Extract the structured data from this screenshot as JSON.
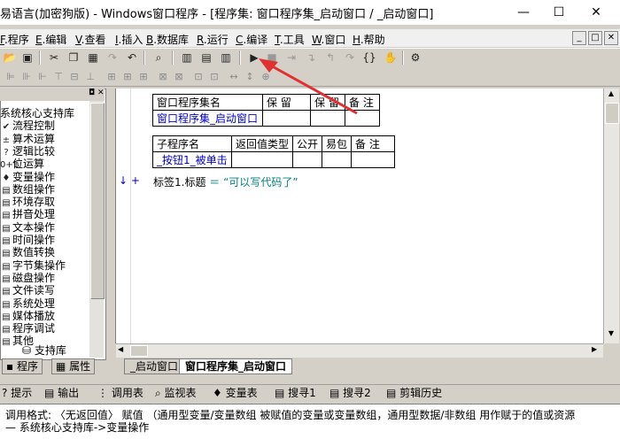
{
  "window": {
    "title": "易语言(加密狗版) - Windows窗口程序 - [程序集: 窗口程序集_启动窗口 / _启动窗口]",
    "min": "—",
    "max": "☐",
    "close": "✕"
  },
  "menu": [
    {
      "key": "F",
      "label": ".程序"
    },
    {
      "key": "E",
      "label": ".编辑"
    },
    {
      "key": "V",
      "label": ".查看"
    },
    {
      "key": "I",
      "label": ".插入"
    },
    {
      "key": "B",
      "label": ".数据库"
    },
    {
      "key": "R",
      "label": ".运行"
    },
    {
      "key": "C",
      "label": ".编译"
    },
    {
      "key": "T",
      "label": ".工具"
    },
    {
      "key": "W",
      "label": ".窗口"
    },
    {
      "key": "H",
      "label": ".帮助"
    }
  ],
  "mdi_controls": [
    "_",
    "□",
    "✕"
  ],
  "toolbar_icons": [
    "open-icon",
    "save-icon",
    "cut-icon",
    "copy-icon",
    "paste-icon",
    "redo-icon",
    "undo-icon",
    "find-icon",
    "layout1-icon",
    "layout2-icon",
    "layout3-icon",
    "run-icon",
    "stop-icon",
    "step-icon",
    "stepin-icon",
    "stepout-icon",
    "stepover-icon",
    "breakpoint-icon",
    "hand-icon",
    "tool-icon"
  ],
  "sidebar": {
    "items": [
      {
        "icon": "",
        "label": "系统核心支持库"
      },
      {
        "icon": "✔",
        "label": "流程控制"
      },
      {
        "icon": "±",
        "label": "算术运算"
      },
      {
        "icon": "?",
        "label": "逻辑比较"
      },
      {
        "icon": "0+1",
        "label": "位运算"
      },
      {
        "icon": "♦",
        "label": "变量操作"
      },
      {
        "icon": "▤",
        "label": "数组操作"
      },
      {
        "icon": "▤",
        "label": "环境存取"
      },
      {
        "icon": "▤",
        "label": "拼音处理"
      },
      {
        "icon": "▤",
        "label": "文本操作"
      },
      {
        "icon": "▤",
        "label": "时间操作"
      },
      {
        "icon": "▤",
        "label": "数值转换"
      },
      {
        "icon": "▤",
        "label": "字节集操作"
      },
      {
        "icon": "▤",
        "label": "磁盘操作"
      },
      {
        "icon": "▤",
        "label": "文件读写"
      },
      {
        "icon": "▤",
        "label": "系统处理"
      },
      {
        "icon": "▤",
        "label": "媒体播放"
      },
      {
        "icon": "▤",
        "label": "程序调试"
      },
      {
        "icon": "▤",
        "label": "其他"
      }
    ],
    "support_lib": "支持库",
    "tabs": [
      "程序",
      "属性"
    ]
  },
  "editor": {
    "assembly_table": {
      "headers": [
        "窗口程序集名",
        "保 留",
        "保 留",
        "备 注"
      ],
      "row": [
        "窗口程序集_启动窗口",
        "",
        "",
        ""
      ]
    },
    "sub_table": {
      "headers": [
        "子程序名",
        "返回值类型",
        "公开",
        "易包",
        "备 注"
      ],
      "row": [
        "_按钮1_被单击",
        "",
        "",
        "",
        ""
      ]
    },
    "code_markers": "↓ +",
    "code_line": {
      "lhs": "标签1.标题",
      "op": "＝",
      "rhs": "“可以写代码了”"
    }
  },
  "doc_tabs": [
    "_启动窗口",
    "窗口程序集_启动窗口"
  ],
  "output_tabs": [
    {
      "icon": "?",
      "label": "提示"
    },
    {
      "icon": "▤",
      "label": "输出"
    },
    {
      "icon": "⋮",
      "label": "调用表"
    },
    {
      "icon": "⌕",
      "label": "监视表"
    },
    {
      "icon": "♦",
      "label": "变量表"
    },
    {
      "icon": "▤",
      "label": "搜寻1"
    },
    {
      "icon": "▤",
      "label": "搜寻2"
    },
    {
      "icon": "▤",
      "label": "剪辑历史"
    }
  ],
  "status": {
    "line1": "调用格式: 〈无返回值〉 赋值 （通用型变量/变量数组 被赋值的变量或变量数组，通用型数据/非数组 用作赋于的值或资源",
    "line2": "— 系统核心支持库->变量操作"
  },
  "colors": {
    "arrow": "#e03030",
    "blue_text": "#0000c8",
    "green_text": "#008080"
  }
}
